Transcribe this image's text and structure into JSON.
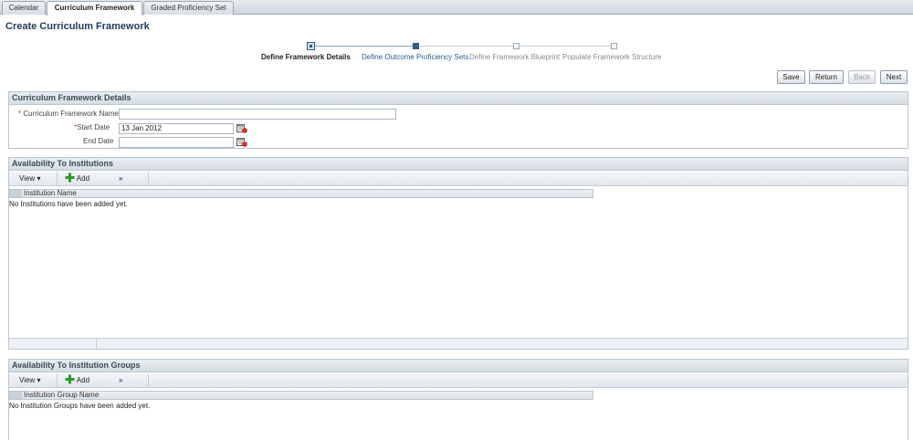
{
  "tabs": [
    {
      "label": "Calendar"
    },
    {
      "label": "Curriculum Framework"
    },
    {
      "label": "Graded Proficiency Set"
    }
  ],
  "page": {
    "title": "Create Curriculum Framework"
  },
  "train": {
    "steps": [
      {
        "label": "Define Framework Details",
        "state": "current"
      },
      {
        "label": "Define Outcome Proficiency Sets",
        "state": "visited"
      },
      {
        "label": "Define Framework Blueprint",
        "state": "future"
      },
      {
        "label": "Populate Framework Structure",
        "state": "future"
      }
    ]
  },
  "buttons": {
    "save": "Save",
    "return": "Return",
    "back": "Back",
    "next": "Next"
  },
  "details": {
    "header": "Curriculum Framework Details",
    "required_marker": "*",
    "name_label": "Curriculum Framework Name",
    "name_value": "",
    "start_label": "Start Date",
    "start_value": "13 Jan 2012",
    "end_label": "End Date",
    "end_value": ""
  },
  "institutions": {
    "header": "Availability To Institutions",
    "view_label": "View",
    "add_label": "Add",
    "more_label": "»",
    "column": "Institution Name",
    "empty": "No Institutions have been added yet."
  },
  "groups": {
    "header": "Availability To Institution Groups",
    "view_label": "View",
    "add_label": "Add",
    "more_label": "»",
    "column": "Institution Group Name",
    "empty": "No Institution Groups have been added yet."
  },
  "icons": {
    "calendar": "calendar-icon",
    "add": "add-icon",
    "dropdown": "chevron-down-icon"
  },
  "colors": {
    "title": "#1d3a5e",
    "train_visited": "#2a5c8a",
    "add_icon": "#2e9a2e",
    "required": "#c03232"
  }
}
